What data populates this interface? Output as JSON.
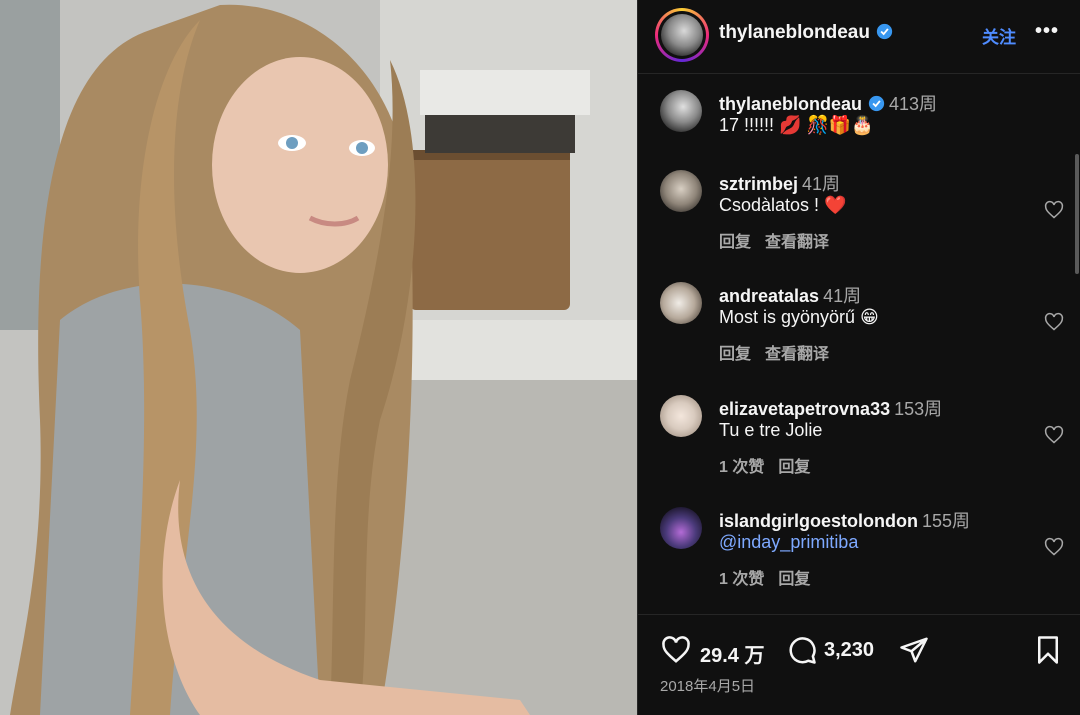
{
  "post": {
    "author": "thylaneblondeau",
    "follow_label": "关注",
    "more_label": "•••",
    "caption": {
      "username": "thylaneblondeau",
      "time": "413周",
      "text": "17 !!!!!! 💋 🎊🎁🎂"
    },
    "comments": [
      {
        "username": "sztrimbej",
        "time": "41周",
        "text": "Csodàlatos ! ❤️",
        "likes": "",
        "reply": "回复",
        "translate": "查看翻译"
      },
      {
        "username": "andreatalas",
        "time": "41周",
        "text": "Most is gyönyörű 😁",
        "likes": "",
        "reply": "回复",
        "translate": "查看翻译"
      },
      {
        "username": "elizavetapetrovna33",
        "time": "153周",
        "text": "Tu e tre Jolie",
        "likes": "1 次赞",
        "reply": "回复",
        "translate": ""
      },
      {
        "username": "islandgirlgoestolondon",
        "time": "155周",
        "text": "@inday_primitiba",
        "likes": "1 次赞",
        "reply": "回复",
        "translate": ""
      }
    ],
    "like_count": "29.4 万",
    "comment_count": "3,230",
    "date": "2018年4月5日"
  },
  "colors": {
    "panel_bg": "#101010",
    "accent": "#4f8cff",
    "verified": "#3897f0",
    "heart_red": "#e0245e"
  },
  "icons": [
    "verified-badge-icon",
    "more-icon",
    "heart-icon",
    "comment-icon",
    "share-icon",
    "bookmark-icon"
  ]
}
